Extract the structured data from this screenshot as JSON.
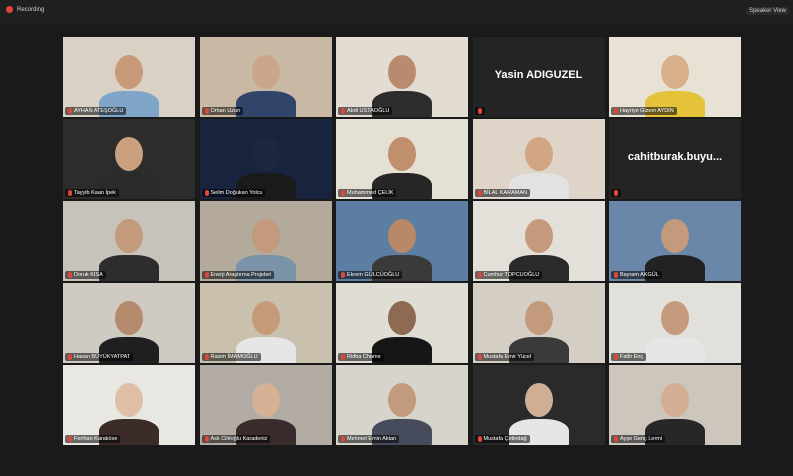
{
  "window": {
    "recording_label": "Recording",
    "speaker_view_label": "Speaker View"
  },
  "participants": [
    {
      "name": "AYHAN ATEŞOĞLU",
      "bg": "#d9d2c4",
      "skin": "#c99a7a",
      "shirt": "#7fa6c9",
      "video": true
    },
    {
      "name": "Orhan Uzun",
      "bg": "#c9b9a4",
      "skin": "#caa58c",
      "shirt": "#31446a",
      "video": true
    },
    {
      "name": "Abdi USTAOĞLU",
      "bg": "#e3dcd2",
      "skin": "#b98a6e",
      "shirt": "#2d2d2d",
      "video": true
    },
    {
      "name": "Yasin ADIGUZEL",
      "video": false
    },
    {
      "name": "Hayriye Gizem AYDIN",
      "bg": "#e8e2d5",
      "skin": "#d8b089",
      "shirt": "#e4c33a",
      "video": true
    },
    {
      "name": "Tayyib Kaan İpek",
      "bg": "#2c2c2c",
      "skin": "#caa07e",
      "shirt": "#2a2a2a",
      "video": true
    },
    {
      "name": "Selim Doğukan Yolcu",
      "bg": "#18243d",
      "skin": "#1c2740",
      "shirt": "#1a1a1a",
      "video": true
    },
    {
      "name": "Muhammed ÇELİK",
      "bg": "#e5e0d4",
      "skin": "#c08f6c",
      "shirt": "#262626",
      "video": true
    },
    {
      "name": "BİLAL KARAMAN",
      "bg": "#ded4c8",
      "skin": "#d2a585",
      "shirt": "#e2e2e2",
      "video": true
    },
    {
      "name": "cahitburak.buyu...",
      "video": false
    },
    {
      "name": "Doruk KISA",
      "bg": "#c7c3ba",
      "skin": "#c49a7c",
      "shirt": "#2d2d2d",
      "video": true
    },
    {
      "name": "Enerji Araştırma Projeleri",
      "bg": "#b3aa9c",
      "skin": "#c49a7c",
      "shirt": "#7b93a8",
      "video": true
    },
    {
      "name": "Ekrem GÜLCÜOĞLU",
      "bg": "#5c7ea2",
      "skin": "#b88868",
      "shirt": "#3a3a3a",
      "video": true
    },
    {
      "name": "Cumhur TOPCUOĞLU",
      "bg": "#e3e0d9",
      "skin": "#c59b7d",
      "shirt": "#2a2a2a",
      "video": true
    },
    {
      "name": "Bayram AKGÜL",
      "bg": "#6a86a9",
      "skin": "#c49a7c",
      "shirt": "#222222",
      "video": true
    },
    {
      "name": "Hasan BÜYÜKYATPAT",
      "bg": "#cfcbc3",
      "skin": "#b58b6e",
      "shirt": "#1f1f1f",
      "video": true
    },
    {
      "name": "Rasim İMAMOĞLU",
      "bg": "#c9c0ad",
      "skin": "#c69b7a",
      "shirt": "#e6e6e6",
      "video": true
    },
    {
      "name": "Ridba Chame",
      "bg": "#e0ddd5",
      "skin": "#8f6a52",
      "shirt": "#161616",
      "video": true
    },
    {
      "name": "Mustafa Emir Yücel",
      "bg": "#d4cec4",
      "skin": "#c49a7c",
      "shirt": "#3a3a3a",
      "video": true
    },
    {
      "name": "Fatih Enç",
      "bg": "#e1e0da",
      "skin": "#c59b7d",
      "shirt": "#e6e6e6",
      "video": true
    },
    {
      "name": "Ferihan Karaköse",
      "bg": "#e9e7e2",
      "skin": "#e0bfa6",
      "shirt": "#3b2c2a",
      "video": true
    },
    {
      "name": "Aslı Ciliroğlu Karadeniz",
      "bg": "#b2aca4",
      "skin": "#d7b195",
      "shirt": "#3a2c2c",
      "video": true
    },
    {
      "name": "Mehmet Emin Aktan",
      "bg": "#d7d4cc",
      "skin": "#c39a7c",
      "shirt": "#464c5c",
      "video": true
    },
    {
      "name": "Mustafa Çetindağ",
      "bg": "#2a2a2a",
      "skin": "#cfae96",
      "shirt": "#e6e6e6",
      "video": true
    },
    {
      "name": "Ayşe Genç Lermi",
      "bg": "#ccc6bd",
      "skin": "#d4ae93",
      "shirt": "#272727",
      "video": true
    }
  ]
}
